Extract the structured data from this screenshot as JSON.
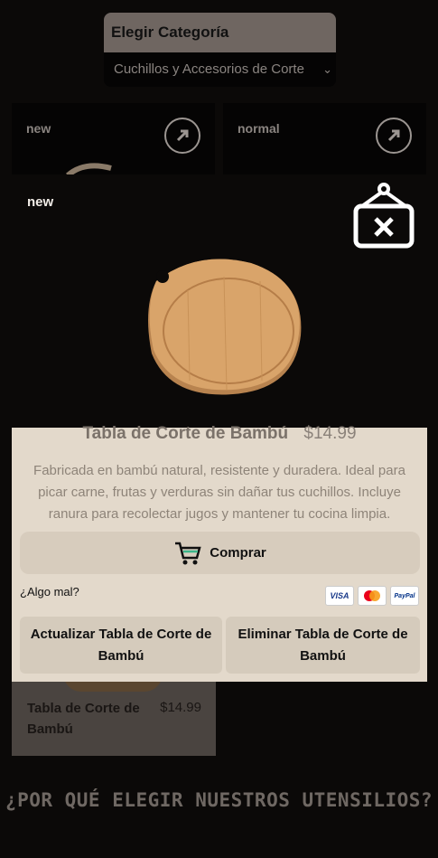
{
  "category": {
    "title": "Elegir Categoría",
    "selected": "Cuchillos y Accesorios de Corte"
  },
  "background_cards": [
    {
      "badge": "new"
    },
    {
      "badge": "normal"
    }
  ],
  "bottom_card": {
    "name": "Tabla de Corte de Bambú",
    "price": "$14.99"
  },
  "modal": {
    "badge": "new",
    "product_name": "Tabla de Corte de Bambú",
    "price": "$14.99",
    "description": "Fabricada en bambú natural, resistente y duradera. Ideal para picar carne, frutas y verduras sin dañar tus cuchillos. Incluye ranura para recolectar jugos y mantener tu cocina limpia.",
    "buy_label": "Comprar",
    "report_label": "¿Algo mal?",
    "payment_labels": [
      "VISA",
      "PayPal"
    ],
    "update_label": "Actualizar Tabla de Corte de Bambú",
    "delete_label": "Eliminar Tabla de Corte de Bambú"
  },
  "section_heading": "¿POR QUÉ ELEGIR NUESTROS UTENSILIOS?",
  "colors": {
    "background": "#0b0908",
    "modal_body": "#e3d9cb",
    "button": "#d7ccbd"
  }
}
